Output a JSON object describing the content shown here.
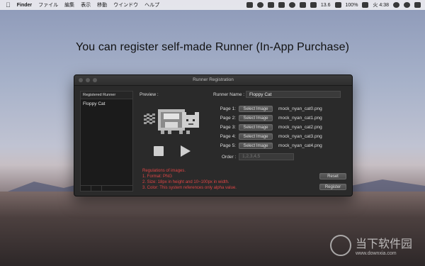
{
  "menubar": {
    "items": [
      "Finder",
      "ファイル",
      "編集",
      "表示",
      "移動",
      "ウインドウ",
      "ヘルプ"
    ],
    "battery": "13.6",
    "status_right": "100%",
    "clock": "火 4:38"
  },
  "headline": "You can register self-made Runner (In-App Purchase)",
  "window": {
    "title": "Runner Registration",
    "sidebar": {
      "header": "Registered Runner",
      "items": [
        "Floppy Cat"
      ]
    },
    "preview_label": "Preview :",
    "runner_name_label": "Runner Name :",
    "runner_name_value": "Floppy Cat",
    "select_image_label": "Select Image",
    "pages": [
      {
        "label": "Page 1:",
        "file": "mock_nyan_cat0.png"
      },
      {
        "label": "Page 2:",
        "file": "mock_nyan_cat1.png"
      },
      {
        "label": "Page 3:",
        "file": "mock_nyan_cat2.png"
      },
      {
        "label": "Page 4:",
        "file": "mock_nyan_cat3.png"
      },
      {
        "label": "Page 5:",
        "file": "mock_nyan_cat4.png"
      }
    ],
    "order_label": "Order :",
    "order_placeholder": "1,2,3,4,5",
    "regulations": [
      "Regulations of images.",
      "1. Format: PNG",
      "2. Size: 18px in height and 10~100px in width.",
      "3. Color: This system references only alpha value."
    ],
    "reset_label": "Reset",
    "register_label": "Register"
  },
  "watermark": {
    "name": "当下软件园",
    "url": "www.downxia.com"
  }
}
